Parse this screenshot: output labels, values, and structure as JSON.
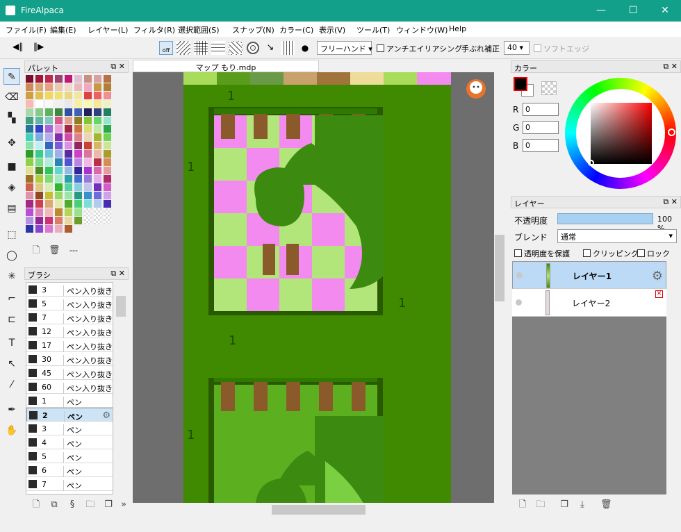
{
  "window": {
    "title": "FireAlpaca",
    "min": "—",
    "max": "☐",
    "close": "✕"
  },
  "menu": [
    "ファイル(F)",
    "編集(E)",
    "レイヤー(L)",
    "フィルタ(R)",
    "選択範囲(S)",
    "スナップ(N)",
    "カラー(C)",
    "表示(V)",
    "ツール(T)",
    "ウィンドウ(W)",
    "Help"
  ],
  "toolbar": {
    "snap_off": "off",
    "stroke_mode": "フリーハンド",
    "antialias": "アンチエイリアシング",
    "stabilizer_label": "手ぶれ補正",
    "stabilizer_value": "40",
    "soft_edge": "ソフトエッジ"
  },
  "palette": {
    "title": "パレット",
    "count_text": "---"
  },
  "brush": {
    "title": "ブラシ",
    "items": [
      {
        "size": "3",
        "name": "ペン入り抜き"
      },
      {
        "size": "5",
        "name": "ペン入り抜き"
      },
      {
        "size": "7",
        "name": "ペン入り抜き"
      },
      {
        "size": "12",
        "name": "ペン入り抜き"
      },
      {
        "size": "17",
        "name": "ペン入り抜き"
      },
      {
        "size": "30",
        "name": "ペン入り抜き"
      },
      {
        "size": "45",
        "name": "ペン入り抜き"
      },
      {
        "size": "60",
        "name": "ペン入り抜き"
      },
      {
        "size": "1",
        "name": "ペン"
      },
      {
        "size": "2",
        "name": "ペン"
      },
      {
        "size": "3",
        "name": "ペン"
      },
      {
        "size": "4",
        "name": "ペン"
      },
      {
        "size": "5",
        "name": "ペン"
      },
      {
        "size": "6",
        "name": "ペン"
      },
      {
        "size": "7",
        "name": "ペン"
      }
    ],
    "selected_index": 9
  },
  "document": {
    "tab": "マップ もり.mdp",
    "labels": [
      "1",
      "1",
      "1",
      "1",
      "1"
    ]
  },
  "color": {
    "title": "カラー",
    "r_label": "R",
    "g_label": "G",
    "b_label": "B",
    "r": "0",
    "g": "0",
    "b": "0",
    "fg": "#000000"
  },
  "layer": {
    "title": "レイヤー",
    "opacity_label": "不透明度",
    "opacity_value": "100 %",
    "opacity_fraction": 1.0,
    "blend_label": "ブレンド",
    "blend_value": "通常",
    "protect_alpha": "透明度を保護",
    "clipping": "クリッピング",
    "lock": "ロック",
    "layers": [
      {
        "name": "レイヤー1"
      },
      {
        "name": "レイヤー2"
      }
    ]
  },
  "colors": {
    "titlebar": "#13a08a",
    "grass": "#3f8a00",
    "pink": "#f28af0",
    "lightgreen": "#b3e67a",
    "trunk": "#8b5a2b",
    "tree": "#3c8a10"
  }
}
